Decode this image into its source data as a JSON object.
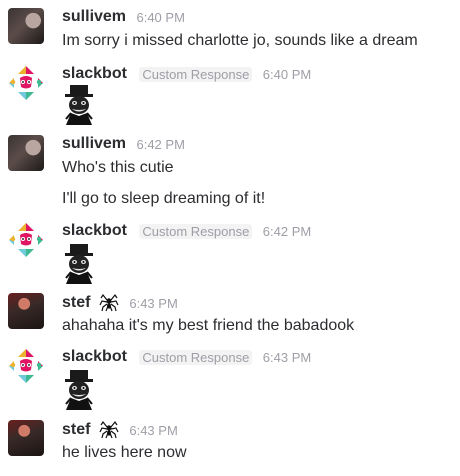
{
  "messages": [
    {
      "user": "sullivem",
      "time": "6:40 PM",
      "lines": [
        "Im sorry i missed charlotte jo, sounds like a dream"
      ]
    },
    {
      "user": "slackbot",
      "badge": "Custom Response",
      "time": "6:40 PM",
      "emoji": "babadook"
    },
    {
      "user": "sullivem",
      "time": "6:42 PM",
      "lines": [
        "Who's this cutie",
        "I'll go to sleep dreaming of it!"
      ]
    },
    {
      "user": "slackbot",
      "badge": "Custom Response",
      "time": "6:42 PM",
      "emoji": "babadook"
    },
    {
      "user": "stef",
      "time": "6:43 PM",
      "status_icon": "spider-icon",
      "lines": [
        "ahahaha it's my best friend the babadook"
      ]
    },
    {
      "user": "slackbot",
      "badge": "Custom Response",
      "time": "6:43 PM",
      "emoji": "babadook"
    },
    {
      "user": "stef",
      "time": "6:43 PM",
      "status_icon": "spider-icon",
      "lines": [
        "he lives here now"
      ]
    }
  ]
}
